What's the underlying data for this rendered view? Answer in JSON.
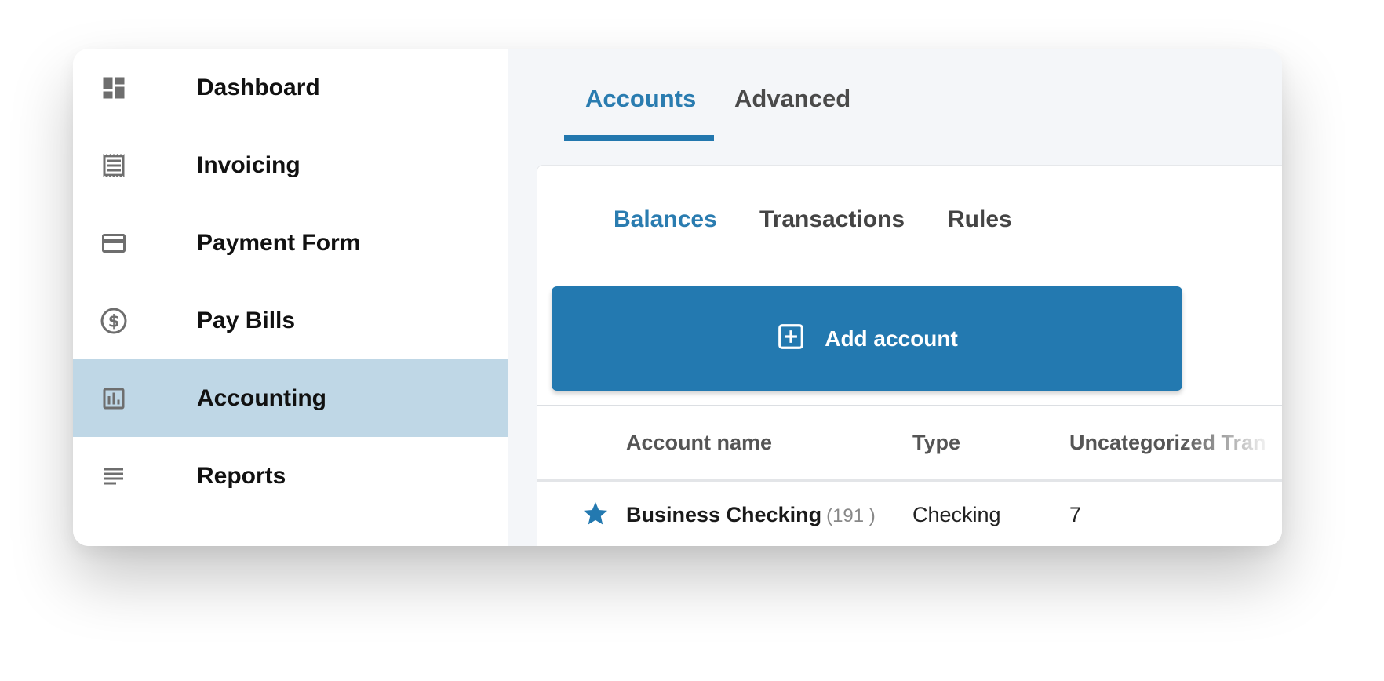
{
  "sidebar": {
    "items": [
      {
        "label": "Dashboard",
        "icon": "dashboard-icon",
        "active": false
      },
      {
        "label": "Invoicing",
        "icon": "receipt-icon",
        "active": false
      },
      {
        "label": "Payment Form",
        "icon": "credit-card-icon",
        "active": false
      },
      {
        "label": "Pay Bills",
        "icon": "dollar-circle-icon",
        "active": false
      },
      {
        "label": "Accounting",
        "icon": "bar-chart-icon",
        "active": true
      },
      {
        "label": "Reports",
        "icon": "lines-icon",
        "active": false
      }
    ]
  },
  "main": {
    "tabs": [
      {
        "label": "Accounts",
        "active": true
      },
      {
        "label": "Advanced",
        "active": false
      }
    ],
    "subtabs": [
      {
        "label": "Balances",
        "active": true
      },
      {
        "label": "Transactions",
        "active": false
      },
      {
        "label": "Rules",
        "active": false
      }
    ],
    "add_button_label": "Add account",
    "table": {
      "columns": [
        "Account name",
        "Type",
        "Uncategorized Tran"
      ],
      "rows": [
        {
          "name": "Business Checking",
          "count": "(191 )",
          "type": "Checking",
          "uncategorized": "7",
          "starred": true
        }
      ]
    }
  },
  "colors": {
    "accent": "#2379b0",
    "active_nav_bg": "#bfd7e6",
    "icon_gray": "#6e6e6e",
    "main_bg": "#f4f6f9"
  }
}
